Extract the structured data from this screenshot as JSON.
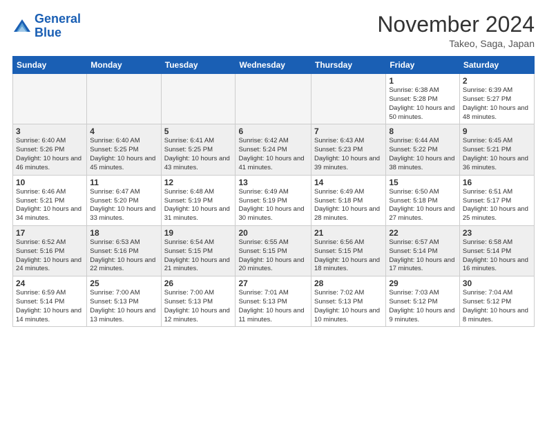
{
  "header": {
    "logo_line1": "General",
    "logo_line2": "Blue",
    "month_title": "November 2024",
    "location": "Takeo, Saga, Japan"
  },
  "days_of_week": [
    "Sunday",
    "Monday",
    "Tuesday",
    "Wednesday",
    "Thursday",
    "Friday",
    "Saturday"
  ],
  "weeks": [
    [
      {
        "date": "",
        "info": ""
      },
      {
        "date": "",
        "info": ""
      },
      {
        "date": "",
        "info": ""
      },
      {
        "date": "",
        "info": ""
      },
      {
        "date": "",
        "info": ""
      },
      {
        "date": "1",
        "info": "Sunrise: 6:38 AM\nSunset: 5:28 PM\nDaylight: 10 hours and 50 minutes."
      },
      {
        "date": "2",
        "info": "Sunrise: 6:39 AM\nSunset: 5:27 PM\nDaylight: 10 hours and 48 minutes."
      }
    ],
    [
      {
        "date": "3",
        "info": "Sunrise: 6:40 AM\nSunset: 5:26 PM\nDaylight: 10 hours and 46 minutes."
      },
      {
        "date": "4",
        "info": "Sunrise: 6:40 AM\nSunset: 5:25 PM\nDaylight: 10 hours and 45 minutes."
      },
      {
        "date": "5",
        "info": "Sunrise: 6:41 AM\nSunset: 5:25 PM\nDaylight: 10 hours and 43 minutes."
      },
      {
        "date": "6",
        "info": "Sunrise: 6:42 AM\nSunset: 5:24 PM\nDaylight: 10 hours and 41 minutes."
      },
      {
        "date": "7",
        "info": "Sunrise: 6:43 AM\nSunset: 5:23 PM\nDaylight: 10 hours and 39 minutes."
      },
      {
        "date": "8",
        "info": "Sunrise: 6:44 AM\nSunset: 5:22 PM\nDaylight: 10 hours and 38 minutes."
      },
      {
        "date": "9",
        "info": "Sunrise: 6:45 AM\nSunset: 5:21 PM\nDaylight: 10 hours and 36 minutes."
      }
    ],
    [
      {
        "date": "10",
        "info": "Sunrise: 6:46 AM\nSunset: 5:21 PM\nDaylight: 10 hours and 34 minutes."
      },
      {
        "date": "11",
        "info": "Sunrise: 6:47 AM\nSunset: 5:20 PM\nDaylight: 10 hours and 33 minutes."
      },
      {
        "date": "12",
        "info": "Sunrise: 6:48 AM\nSunset: 5:19 PM\nDaylight: 10 hours and 31 minutes."
      },
      {
        "date": "13",
        "info": "Sunrise: 6:49 AM\nSunset: 5:19 PM\nDaylight: 10 hours and 30 minutes."
      },
      {
        "date": "14",
        "info": "Sunrise: 6:49 AM\nSunset: 5:18 PM\nDaylight: 10 hours and 28 minutes."
      },
      {
        "date": "15",
        "info": "Sunrise: 6:50 AM\nSunset: 5:18 PM\nDaylight: 10 hours and 27 minutes."
      },
      {
        "date": "16",
        "info": "Sunrise: 6:51 AM\nSunset: 5:17 PM\nDaylight: 10 hours and 25 minutes."
      }
    ],
    [
      {
        "date": "17",
        "info": "Sunrise: 6:52 AM\nSunset: 5:16 PM\nDaylight: 10 hours and 24 minutes."
      },
      {
        "date": "18",
        "info": "Sunrise: 6:53 AM\nSunset: 5:16 PM\nDaylight: 10 hours and 22 minutes."
      },
      {
        "date": "19",
        "info": "Sunrise: 6:54 AM\nSunset: 5:15 PM\nDaylight: 10 hours and 21 minutes."
      },
      {
        "date": "20",
        "info": "Sunrise: 6:55 AM\nSunset: 5:15 PM\nDaylight: 10 hours and 20 minutes."
      },
      {
        "date": "21",
        "info": "Sunrise: 6:56 AM\nSunset: 5:15 PM\nDaylight: 10 hours and 18 minutes."
      },
      {
        "date": "22",
        "info": "Sunrise: 6:57 AM\nSunset: 5:14 PM\nDaylight: 10 hours and 17 minutes."
      },
      {
        "date": "23",
        "info": "Sunrise: 6:58 AM\nSunset: 5:14 PM\nDaylight: 10 hours and 16 minutes."
      }
    ],
    [
      {
        "date": "24",
        "info": "Sunrise: 6:59 AM\nSunset: 5:14 PM\nDaylight: 10 hours and 14 minutes."
      },
      {
        "date": "25",
        "info": "Sunrise: 7:00 AM\nSunset: 5:13 PM\nDaylight: 10 hours and 13 minutes."
      },
      {
        "date": "26",
        "info": "Sunrise: 7:00 AM\nSunset: 5:13 PM\nDaylight: 10 hours and 12 minutes."
      },
      {
        "date": "27",
        "info": "Sunrise: 7:01 AM\nSunset: 5:13 PM\nDaylight: 10 hours and 11 minutes."
      },
      {
        "date": "28",
        "info": "Sunrise: 7:02 AM\nSunset: 5:13 PM\nDaylight: 10 hours and 10 minutes."
      },
      {
        "date": "29",
        "info": "Sunrise: 7:03 AM\nSunset: 5:12 PM\nDaylight: 10 hours and 9 minutes."
      },
      {
        "date": "30",
        "info": "Sunrise: 7:04 AM\nSunset: 5:12 PM\nDaylight: 10 hours and 8 minutes."
      }
    ]
  ],
  "row_shades": [
    "light",
    "dark",
    "light",
    "dark",
    "light"
  ]
}
